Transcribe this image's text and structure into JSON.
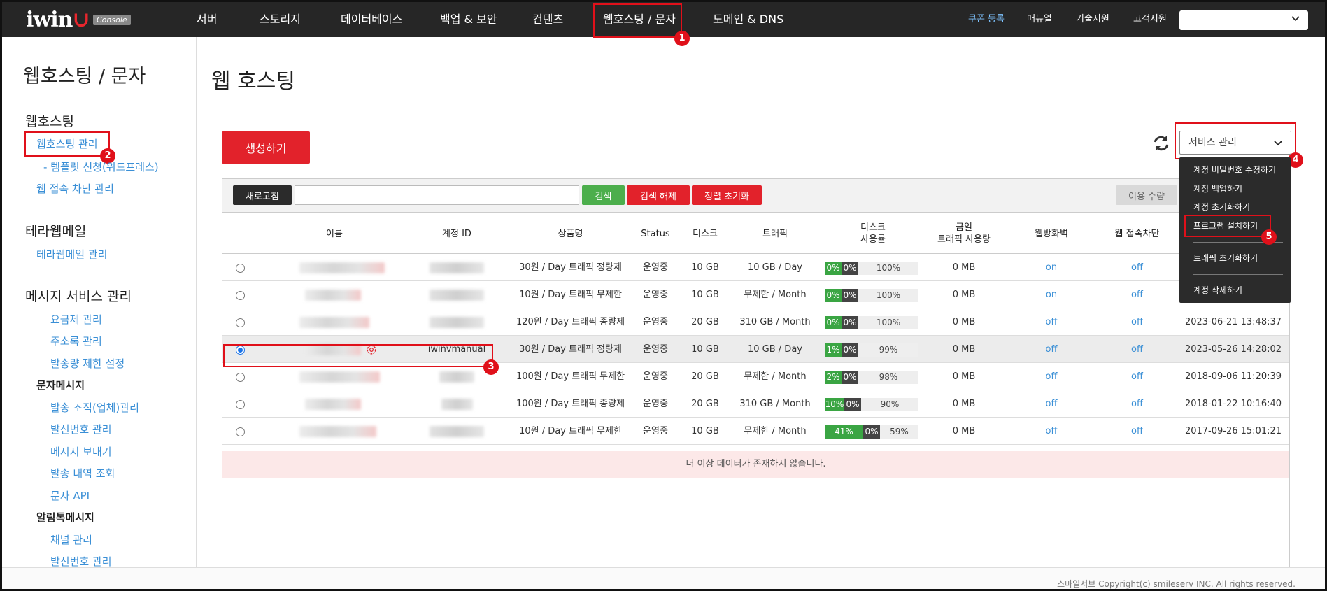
{
  "brand": {
    "logo_text": "iwin",
    "logo_mark": "∪",
    "badge": "Console"
  },
  "nav": {
    "items": [
      "서버",
      "스토리지",
      "데이터베이스",
      "백업 & 보안",
      "컨텐츠",
      "웹호스팅 / 문자",
      "도메인 & DNS"
    ],
    "right": [
      "쿠폰 등록",
      "매뉴얼",
      "기술지원",
      "고객지원"
    ],
    "select_value": ""
  },
  "sidebar": {
    "title": "웹호스팅 / 문자",
    "sec_webhosting": "웹호스팅",
    "webhosting_manage": "웹호스팅 관리",
    "template": "- 템플릿 신청(워드프레스)",
    "block_manage": "웹 접속 차단 관리",
    "sec_terra": "테라웹메일",
    "terra_manage": "테라웹메일 관리",
    "sec_msg": "메시지 서비스 관리",
    "pricing": "요금제 관리",
    "address": "주소록 관리",
    "send_limit": "발송량 제한 설정",
    "sub_sms": "문자메시지",
    "sender_org": "발송 조직(업체)관리",
    "caller_num": "발신번호 관리",
    "send_msg": "메시지 보내기",
    "history": "발송 내역 조회",
    "sms_api": "문자 API",
    "sub_alimtalk": "알림톡메시지",
    "channel": "채널 관리",
    "caller_num2": "발신번호 관리"
  },
  "main": {
    "title": "웹 호스팅",
    "create": "생성하기",
    "service_select": "서비스 관리",
    "toolbar": {
      "refresh": "새로고침",
      "search_value": "",
      "search": "검색",
      "clear": "검색 해제",
      "reset_sort": "정렬 초기화",
      "usage": "이용 수량"
    },
    "columns": [
      "이름",
      "계정 ID",
      "상품명",
      "Status",
      "디스크",
      "트래픽",
      "디스크\n사용률",
      "금일\n트래픽 사용량",
      "웹방화벽",
      "웹 접속차단"
    ],
    "rows": [
      {
        "account": "",
        "product": "30원 / Day 트래픽 정량제",
        "status": "운영중",
        "disk": "10 GB",
        "traffic": "10 GB / Day",
        "g": "0%",
        "k": "0%",
        "pct": "100%",
        "today": "0 MB",
        "waf": "on",
        "block": "off",
        "date": "",
        "used": 0
      },
      {
        "account": "",
        "product": "10원 / Day 트래픽 무제한",
        "status": "운영중",
        "disk": "10 GB",
        "traffic": "무제한 / Month",
        "g": "0%",
        "k": "0%",
        "pct": "100%",
        "today": "0 MB",
        "waf": "on",
        "block": "off",
        "date": "",
        "used": 0
      },
      {
        "account": "",
        "product": "120원 / Day 트래픽 종량제",
        "status": "운영중",
        "disk": "20 GB",
        "traffic": "310 GB / Month",
        "g": "0%",
        "k": "0%",
        "pct": "100%",
        "today": "0 MB",
        "waf": "off",
        "block": "off",
        "date": "2023-06-21 13:48:37",
        "used": 0
      },
      {
        "account": "iwinvmanual",
        "product": "30원 / Day 트래픽 정량제",
        "status": "운영중",
        "disk": "10 GB",
        "traffic": "10 GB / Day",
        "g": "1%",
        "k": "0%",
        "pct": "99%",
        "today": "0 MB",
        "waf": "off",
        "block": "off",
        "date": "2023-05-26 14:28:02",
        "used": 0.01
      },
      {
        "account": "",
        "product": "100원 / Day 트래픽 무제한",
        "status": "운영중",
        "disk": "20 GB",
        "traffic": "무제한 / Month",
        "g": "2%",
        "k": "0%",
        "pct": "98%",
        "today": "0 MB",
        "waf": "off",
        "block": "off",
        "date": "2018-09-06 11:20:39",
        "used": 0.02
      },
      {
        "account": "",
        "product": "100원 / Day 트래픽 종량제",
        "status": "운영중",
        "disk": "20 GB",
        "traffic": "310 GB / Month",
        "g": "10%",
        "k": "0%",
        "pct": "90%",
        "today": "0 MB",
        "waf": "off",
        "block": "off",
        "date": "2018-01-22 10:16:40",
        "used": 0.1
      },
      {
        "account": "",
        "product": "10원 / Day 트래픽 무제한",
        "status": "운영중",
        "disk": "10 GB",
        "traffic": "무제한 / Month",
        "g": "41%",
        "k": "0%",
        "pct": "59%",
        "today": "0 MB",
        "waf": "off",
        "block": "off",
        "date": "2017-09-26 15:01:21",
        "used": 0.41
      }
    ],
    "no_more": "더 이상 데이터가 존재하지 않습니다."
  },
  "dropdown": {
    "items": [
      "계정 비밀번호 수정하기",
      "계정 백업하기",
      "계정 초기화하기",
      "프로그램 설치하기",
      "트래픽 초기화하기",
      "계정 삭제하기"
    ]
  },
  "badges": [
    "1",
    "2",
    "3",
    "4",
    "5"
  ],
  "footer": "스마일서브 Copyright(c) smileserv INC. All rights reserved.",
  "colors": {
    "accent_red": "#e2222b",
    "link_blue": "#3a8fd6",
    "green": "#3aa543",
    "nav_bg": "#262626"
  }
}
